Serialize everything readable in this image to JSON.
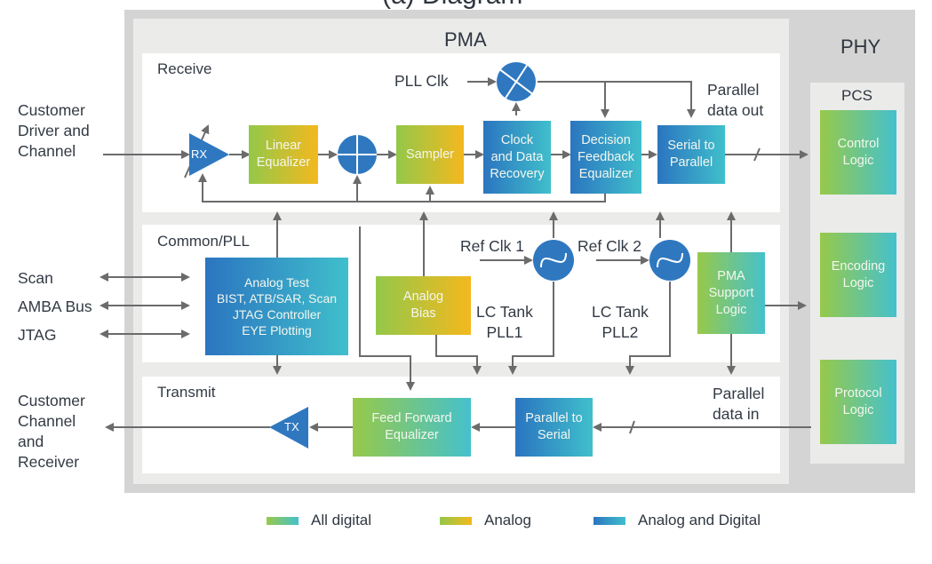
{
  "title_fragment": "(a) Diagram",
  "containers": {
    "phy": "PHY",
    "pma": "PMA",
    "pcs": "PCS"
  },
  "sections": {
    "receive": "Receive",
    "common": "Common/PLL",
    "transmit": "Transmit"
  },
  "external": {
    "rx_source": "Customer\nDriver and\nChannel",
    "scan": "Scan",
    "amba": "AMBA Bus",
    "jtag": "JTAG",
    "tx_dest": "Customer\nChannel\nand\nReceiver"
  },
  "receive_blocks": {
    "rx": "RX",
    "linear_eq": "Linear\nEqualizer",
    "sampler": "Sampler",
    "cdr": "Clock\nand Data\nRecovery",
    "dfe": "Decision\nFeedback\nEqualizer",
    "s2p": "Serial to\nParallel"
  },
  "receive_labels": {
    "pll_clk": "PLL Clk",
    "parallel_out": "Parallel\ndata out"
  },
  "common_blocks": {
    "analog_test": "Analog Test\nBIST, ATB/SAR, Scan\nJTAG Controller\nEYE Plotting",
    "analog_bias": "Analog\nBias",
    "pma_support": "PMA\nSupport\nLogic"
  },
  "common_labels": {
    "ref_clk1": "Ref Clk 1",
    "ref_clk2": "Ref Clk 2",
    "lc_tank1": "LC Tank\nPLL1",
    "lc_tank2": "LC Tank\nPLL2"
  },
  "transmit_blocks": {
    "tx": "TX",
    "ffe": "Feed Forward\nEqualizer",
    "p2s": "Parallel to\nSerial"
  },
  "transmit_labels": {
    "parallel_in": "Parallel\ndata in"
  },
  "pcs_blocks": {
    "control": "Control\nLogic",
    "encoding": "Encoding\nLogic",
    "protocol": "Protocol\nLogic"
  },
  "legend": [
    {
      "label": "All digital",
      "kind": "digital"
    },
    {
      "label": "Analog",
      "kind": "analog"
    },
    {
      "label": "Analog and Digital",
      "kind": "mixed"
    }
  ],
  "colors": {
    "wire": "#6b6b6b",
    "circle_blue": "#2f78c0",
    "frame_outer": "#d4d4d4",
    "frame_inner": "#ebebea"
  }
}
